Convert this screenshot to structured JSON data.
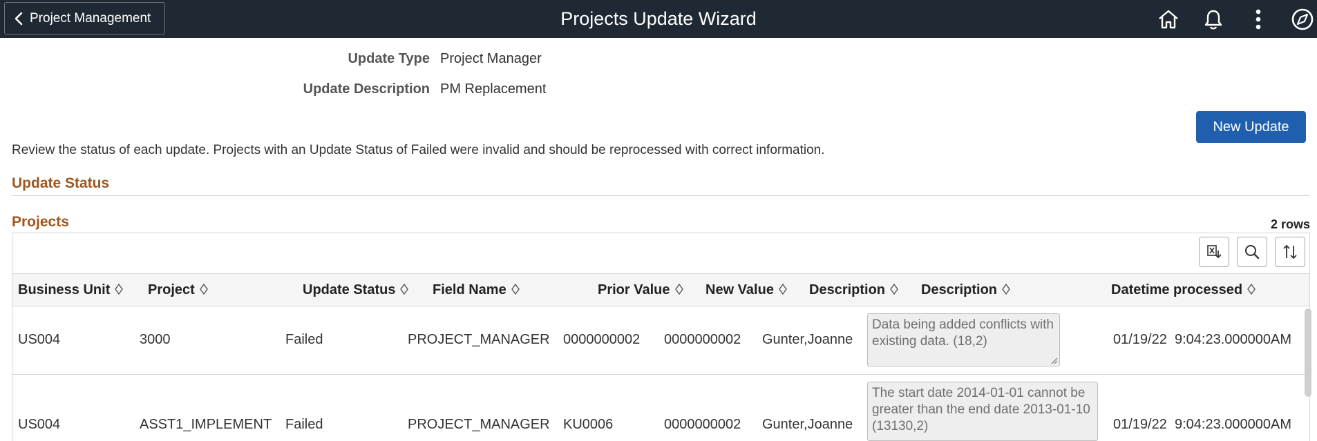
{
  "header": {
    "back_label": "Project Management",
    "title": "Projects Update Wizard",
    "icons": [
      "home-icon",
      "bell-icon",
      "kebab-menu-icon",
      "compass-icon"
    ],
    "background_color": "#1f2933"
  },
  "form": {
    "update_type_label": "Update Type",
    "update_type_value": "Project Manager",
    "update_description_label": "Update Description",
    "update_description_value": "PM Replacement"
  },
  "actions": {
    "new_update_label": "New Update",
    "accent_color": "#1f5fad"
  },
  "instructions": "Review the status of each update. Projects with an Update Status of Failed were invalid and should be reprocessed with correct information.",
  "sections": {
    "update_status": "Update Status",
    "projects": "Projects",
    "section_color": "#a0561c"
  },
  "grid": {
    "row_count": "2 rows",
    "toolbar_icons": [
      "excel-export-icon",
      "search-icon",
      "sort-icon"
    ],
    "columns": [
      "Business Unit",
      "Project",
      "Update Status",
      "Field Name",
      "Prior Value",
      "New Value",
      "Description",
      "Description",
      "Datetime processed"
    ],
    "rows": [
      {
        "business_unit": "US004",
        "project": "3000",
        "status": "Failed",
        "field_name": "PROJECT_MANAGER",
        "prior_value": "0000000002",
        "new_value": "0000000002",
        "description": "Gunter,Joanne",
        "message": "Data being added conflicts with existing data. (18,2)",
        "date": "01/19/22",
        "time": "9:04:23.000000AM"
      },
      {
        "business_unit": "US004",
        "project": "ASST1_IMPLEMENT",
        "status": "Failed",
        "field_name": "PROJECT_MANAGER",
        "prior_value": "KU0006",
        "new_value": "0000000002",
        "description": "Gunter,Joanne",
        "message": "The start date 2014-01-01 cannot be greater than the end date 2013-01-10 (13130,2)",
        "date": "01/19/22",
        "time": "9:04:23.000000AM"
      }
    ]
  }
}
